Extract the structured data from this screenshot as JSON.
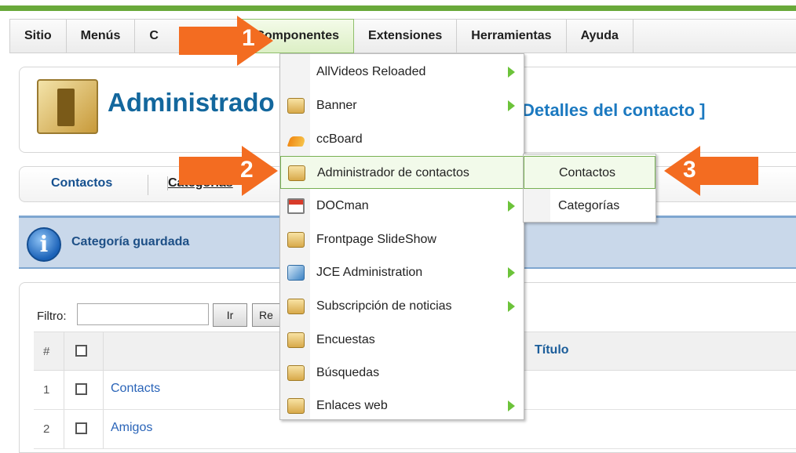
{
  "menubar": {
    "items": [
      {
        "label": "Sitio"
      },
      {
        "label": "Menús"
      },
      {
        "label": "C"
      },
      {
        "label": "Componentes",
        "active": true
      },
      {
        "label": "Extensiones"
      },
      {
        "label": "Herramientas"
      },
      {
        "label": "Ayuda"
      }
    ]
  },
  "header": {
    "title": "Administrado",
    "subtitle": "Detalles del contacto ]",
    "icon": "contacts-folder-icon"
  },
  "tabs": [
    {
      "label": "Contactos"
    },
    {
      "label": "Categorías"
    }
  ],
  "message": {
    "text": "Categoría guardada",
    "icon": "info-icon"
  },
  "filter": {
    "label": "Filtro:",
    "value": "",
    "go_button": "Ir",
    "reset_button": "Re"
  },
  "table": {
    "headers": {
      "num": "#",
      "title": "Título"
    },
    "rows": [
      {
        "num": "1",
        "title": "Contacts"
      },
      {
        "num": "2",
        "title": "Amigos"
      }
    ]
  },
  "dropdown": {
    "items": [
      {
        "label": "AllVideos Reloaded",
        "icon": "none",
        "submenu": true
      },
      {
        "label": "Banner",
        "icon": "component-icon",
        "submenu": true
      },
      {
        "label": "ccBoard",
        "icon": "broom-icon",
        "submenu": false
      },
      {
        "label": "Administrador de contactos",
        "icon": "component-icon",
        "submenu": false,
        "highlighted": true
      },
      {
        "label": "DOCman",
        "icon": "document-icon",
        "submenu": true
      },
      {
        "label": "Frontpage SlideShow",
        "icon": "component-icon",
        "submenu": false
      },
      {
        "label": "JCE Administration",
        "icon": "jce-icon",
        "submenu": true
      },
      {
        "label": "Subscripción de noticias",
        "icon": "component-icon",
        "submenu": true
      },
      {
        "label": "Encuestas",
        "icon": "component-icon",
        "submenu": false
      },
      {
        "label": "Búsquedas",
        "icon": "component-icon",
        "submenu": false
      },
      {
        "label": "Enlaces web",
        "icon": "component-icon",
        "submenu": true
      }
    ]
  },
  "submenu": {
    "items": [
      {
        "label": "Contactos",
        "highlighted": true
      },
      {
        "label": "Categorías"
      }
    ]
  },
  "callouts": [
    "1",
    "2",
    "3"
  ],
  "colors": {
    "accent_green": "#69a93a",
    "title_blue": "#13679d",
    "callout_orange": "#f36c21"
  }
}
